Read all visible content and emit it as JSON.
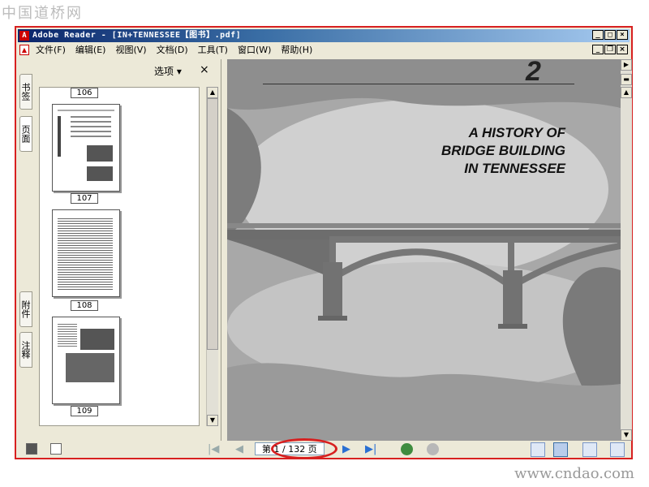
{
  "watermark_top": "中国道桥网",
  "watermark_bottom": "www.cndao.com",
  "window": {
    "title": "Adobe Reader - [IN+TENNESSEE【图书】.pdf]"
  },
  "menus": [
    "文件(F)",
    "编辑(E)",
    "视图(V)",
    "文档(D)",
    "工具(T)",
    "窗口(W)",
    "帮助(H)"
  ],
  "side_tabs": {
    "bookmarks": "书签",
    "pages": "页面",
    "attachments": "附件",
    "comments": "注释"
  },
  "panel": {
    "options": "选项",
    "close": "×"
  },
  "thumbnails": [
    "106",
    "107",
    "108",
    "109"
  ],
  "document": {
    "chapter_number": "2",
    "title": "A HISTORY OF\nBRIDGE BUILDING\nIN TENNESSEE"
  },
  "navigation": {
    "page_display": "第 1 / 132 页"
  },
  "colors": {
    "highlight": "#d72020",
    "titlebar": "#0a246a"
  }
}
